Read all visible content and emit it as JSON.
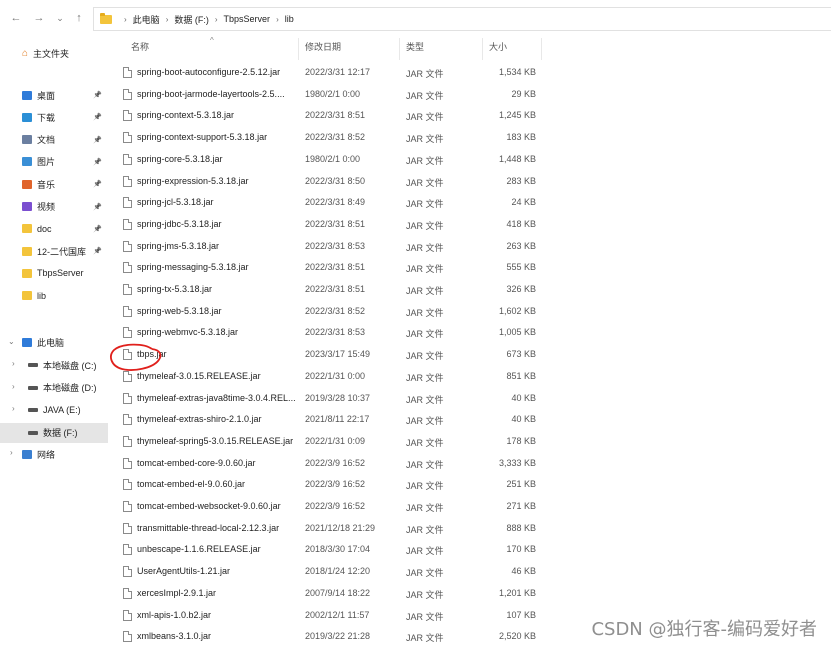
{
  "breadcrumb": [
    "此电脑",
    "数据 (F:)",
    "TbpsServer",
    "lib"
  ],
  "columns": {
    "name": "名称",
    "date": "修改日期",
    "type": "类型",
    "size": "大小"
  },
  "sidebar": {
    "home": "主文件夹",
    "quick": [
      {
        "label": "桌面",
        "icon": "desktop-icon",
        "color": "#2f7bd9",
        "pinned": true
      },
      {
        "label": "下载",
        "icon": "download-icon",
        "color": "#2b8fd6",
        "pinned": true
      },
      {
        "label": "文档",
        "icon": "documents-icon",
        "color": "#6b7fa0",
        "pinned": true
      },
      {
        "label": "图片",
        "icon": "pictures-icon",
        "color": "#3a8fd6",
        "pinned": true
      },
      {
        "label": "音乐",
        "icon": "music-icon",
        "color": "#e0642b",
        "pinned": true
      },
      {
        "label": "视频",
        "icon": "videos-icon",
        "color": "#7b4fd0",
        "pinned": true
      },
      {
        "label": "doc",
        "icon": "folder-icon",
        "color": "#f3c43b",
        "pinned": true
      },
      {
        "label": "12-二代国库",
        "icon": "folder-icon",
        "color": "#f3c43b",
        "pinned": true
      },
      {
        "label": "TbpsServer",
        "icon": "folder-icon",
        "color": "#f3c43b",
        "pinned": false
      },
      {
        "label": "lib",
        "icon": "folder-icon",
        "color": "#f3c43b",
        "pinned": false
      }
    ],
    "this_pc": "此电脑",
    "drives": [
      {
        "label": "本地磁盘 (C:)",
        "icon": "windows-drive-icon"
      },
      {
        "label": "本地磁盘 (D:)",
        "icon": "drive-icon"
      },
      {
        "label": "JAVA (E:)",
        "icon": "drive-icon"
      },
      {
        "label": "数据 (F:)",
        "icon": "drive-icon",
        "selected": true
      }
    ],
    "network": "网络"
  },
  "files": [
    {
      "name": "spring-boot-autoconfigure-2.5.12.jar",
      "date": "2022/3/31 12:17",
      "type": "JAR 文件",
      "size": "1,534 KB"
    },
    {
      "name": "spring-boot-jarmode-layertools-2.5....",
      "date": "1980/2/1 0:00",
      "type": "JAR 文件",
      "size": "29 KB"
    },
    {
      "name": "spring-context-5.3.18.jar",
      "date": "2022/3/31 8:51",
      "type": "JAR 文件",
      "size": "1,245 KB"
    },
    {
      "name": "spring-context-support-5.3.18.jar",
      "date": "2022/3/31 8:52",
      "type": "JAR 文件",
      "size": "183 KB"
    },
    {
      "name": "spring-core-5.3.18.jar",
      "date": "1980/2/1 0:00",
      "type": "JAR 文件",
      "size": "1,448 KB"
    },
    {
      "name": "spring-expression-5.3.18.jar",
      "date": "2022/3/31 8:50",
      "type": "JAR 文件",
      "size": "283 KB"
    },
    {
      "name": "spring-jcl-5.3.18.jar",
      "date": "2022/3/31 8:49",
      "type": "JAR 文件",
      "size": "24 KB"
    },
    {
      "name": "spring-jdbc-5.3.18.jar",
      "date": "2022/3/31 8:51",
      "type": "JAR 文件",
      "size": "418 KB"
    },
    {
      "name": "spring-jms-5.3.18.jar",
      "date": "2022/3/31 8:53",
      "type": "JAR 文件",
      "size": "263 KB"
    },
    {
      "name": "spring-messaging-5.3.18.jar",
      "date": "2022/3/31 8:51",
      "type": "JAR 文件",
      "size": "555 KB"
    },
    {
      "name": "spring-tx-5.3.18.jar",
      "date": "2022/3/31 8:51",
      "type": "JAR 文件",
      "size": "326 KB"
    },
    {
      "name": "spring-web-5.3.18.jar",
      "date": "2022/3/31 8:52",
      "type": "JAR 文件",
      "size": "1,602 KB"
    },
    {
      "name": "spring-webmvc-5.3.18.jar",
      "date": "2022/3/31 8:53",
      "type": "JAR 文件",
      "size": "1,005 KB"
    },
    {
      "name": "tbps.jar",
      "date": "2023/3/17 15:49",
      "type": "JAR 文件",
      "size": "673 KB",
      "circled": true
    },
    {
      "name": "thymeleaf-3.0.15.RELEASE.jar",
      "date": "2022/1/31 0:00",
      "type": "JAR 文件",
      "size": "851 KB"
    },
    {
      "name": "thymeleaf-extras-java8time-3.0.4.REL...",
      "date": "2019/3/28 10:37",
      "type": "JAR 文件",
      "size": "40 KB"
    },
    {
      "name": "thymeleaf-extras-shiro-2.1.0.jar",
      "date": "2021/8/11 22:17",
      "type": "JAR 文件",
      "size": "40 KB"
    },
    {
      "name": "thymeleaf-spring5-3.0.15.RELEASE.jar",
      "date": "2022/1/31 0:09",
      "type": "JAR 文件",
      "size": "178 KB"
    },
    {
      "name": "tomcat-embed-core-9.0.60.jar",
      "date": "2022/3/9 16:52",
      "type": "JAR 文件",
      "size": "3,333 KB"
    },
    {
      "name": "tomcat-embed-el-9.0.60.jar",
      "date": "2022/3/9 16:52",
      "type": "JAR 文件",
      "size": "251 KB"
    },
    {
      "name": "tomcat-embed-websocket-9.0.60.jar",
      "date": "2022/3/9 16:52",
      "type": "JAR 文件",
      "size": "271 KB"
    },
    {
      "name": "transmittable-thread-local-2.12.3.jar",
      "date": "2021/12/18 21:29",
      "type": "JAR 文件",
      "size": "888 KB"
    },
    {
      "name": "unbescape-1.1.6.RELEASE.jar",
      "date": "2018/3/30 17:04",
      "type": "JAR 文件",
      "size": "170 KB"
    },
    {
      "name": "UserAgentUtils-1.21.jar",
      "date": "2018/1/24 12:20",
      "type": "JAR 文件",
      "size": "46 KB"
    },
    {
      "name": "xercesImpl-2.9.1.jar",
      "date": "2007/9/14 18:22",
      "type": "JAR 文件",
      "size": "1,201 KB"
    },
    {
      "name": "xml-apis-1.0.b2.jar",
      "date": "2002/12/1 11:57",
      "type": "JAR 文件",
      "size": "107 KB"
    },
    {
      "name": "xmlbeans-3.1.0.jar",
      "date": "2019/3/22 21:28",
      "type": "JAR 文件",
      "size": "2,520 KB"
    }
  ],
  "watermark": "CSDN @独行客-编码爱好者",
  "colors": {
    "annotation": "#e0201c",
    "selected_bg": "#e5e5e5"
  }
}
